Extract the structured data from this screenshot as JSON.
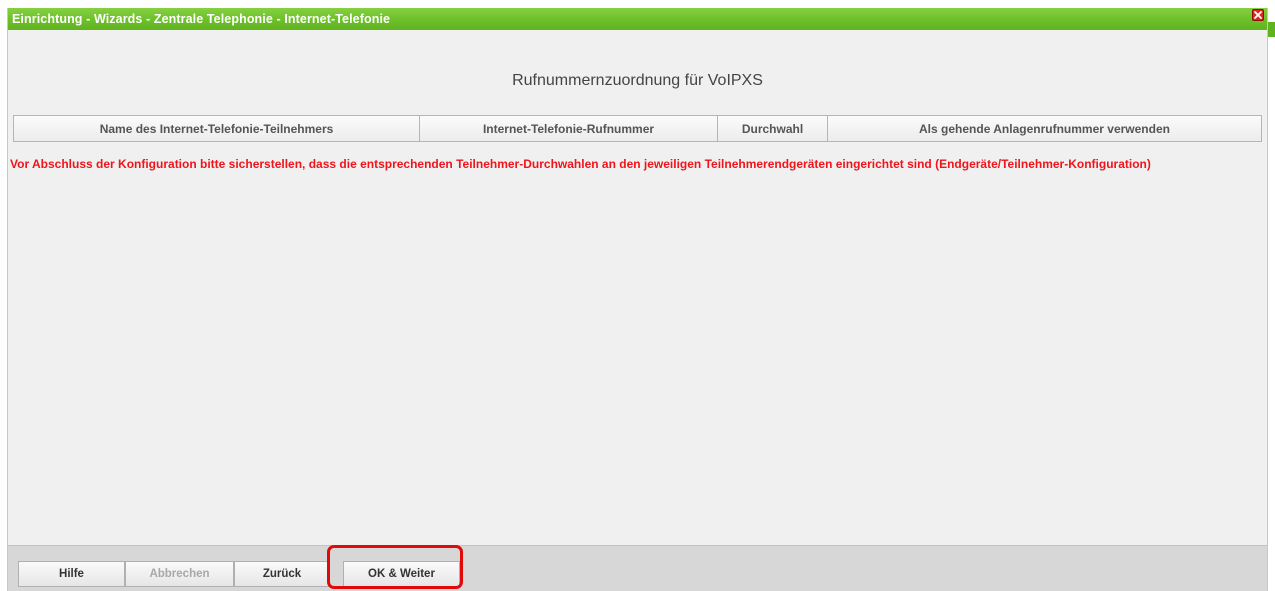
{
  "window": {
    "title": "Einrichtung - Wizards - Zentrale Telephonie - Internet-Telefonie",
    "close_icon": "close-icon"
  },
  "heading": "Rufnummernzuordnung für VoIPXS",
  "table": {
    "columns": [
      "Name des Internet-Telefonie-Teilnehmers",
      "Internet-Telefonie-Rufnummer",
      "Durchwahl",
      "Als gehende Anlagenrufnummer verwenden"
    ]
  },
  "warning": "Vor Abschluss der Konfiguration bitte sicherstellen, dass die entsprechenden Teilnehmer-Durchwahlen an den jeweiligen Teilnehmerendgeräten eingerichtet sind (Endgeräte/Teilnehmer-Konfiguration)",
  "footer": {
    "help": "Hilfe",
    "cancel": "Abbrechen",
    "back": "Zurück",
    "ok_next": "OK & Weiter"
  },
  "colors": {
    "titlebar": "#6fc12c",
    "warning": "#f0141b",
    "highlight": "#e10a0a"
  }
}
